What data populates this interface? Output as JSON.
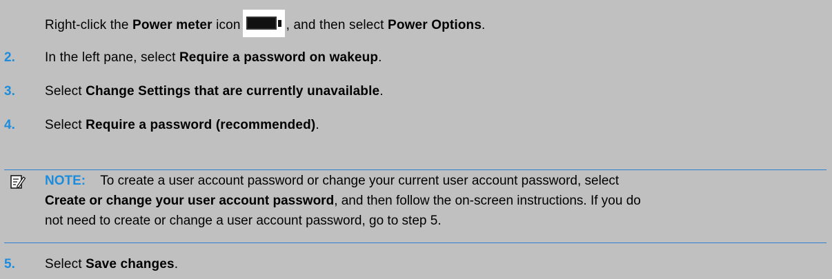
{
  "step1": {
    "pre": "Right-click the ",
    "bold1": "Power meter",
    "mid": " icon",
    "post": ", and then select ",
    "bold2": "Power Options",
    "end": "."
  },
  "step2": {
    "number": "2.",
    "pre": "In the left pane, select ",
    "bold": "Require a password on wakeup",
    "end": "."
  },
  "step3": {
    "number": "3.",
    "pre": "Select ",
    "bold": "Change Settings that are currently unavailable",
    "end": "."
  },
  "step4": {
    "number": "4.",
    "pre": "Select ",
    "bold": "Require a password (recommended)",
    "end": "."
  },
  "note": {
    "label": "NOTE:",
    "line1": "To create a user account password or change your current user account password, select",
    "bold": "Create or change your user account password",
    "line2_rest": ", and then follow the on-screen instructions. If you do",
    "line3": "not need to create or change a user account password, go to step 5."
  },
  "step5": {
    "number": "5.",
    "pre": "Select ",
    "bold": "Save changes",
    "end": "."
  },
  "colors": {
    "accent": "#1d8cdc",
    "background": "#c0c0c0",
    "rule": "#2f7fd0"
  },
  "icons": {
    "battery": "battery-icon",
    "note": "note-pencil-icon"
  }
}
